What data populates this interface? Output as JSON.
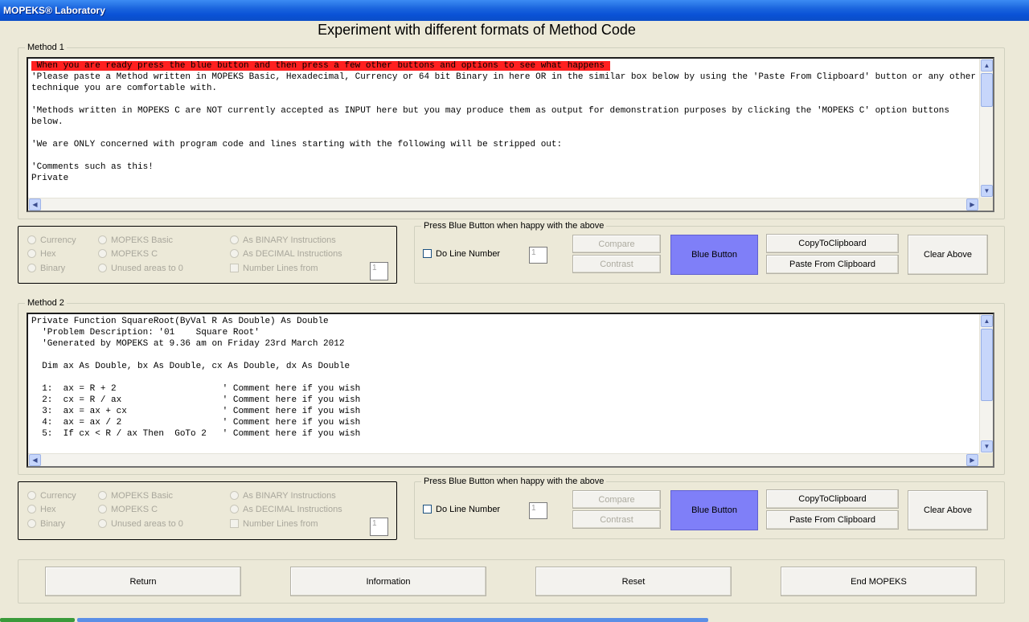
{
  "window": {
    "title": "MOPEKS® Laboratory"
  },
  "page_title": "Experiment with different formats of Method Code",
  "method1": {
    "legend": "Method 1",
    "highlight": " When you are ready press the blue button and then press a few other buttons and options to see what happens ",
    "text": "'Please paste a Method written in MOPEKS Basic, Hexadecimal, Currency or 64 bit Binary in here OR in the similar box below by using the 'Paste From Clipboard' button or any other technique you are comfortable with.\n\n'Methods written in MOPEKS C are NOT currently accepted as INPUT here but you may produce them as output for demonstration purposes by clicking the 'MOPEKS C' option buttons below.\n\n'We are ONLY concerned with program code and lines starting with the following will be stripped out:\n\n'Comments such as this!\nPrivate"
  },
  "method2": {
    "legend": "Method 2",
    "text": "Private Function SquareRoot(ByVal R As Double) As Double\n  'Problem Description: '01    Square Root'\n  'Generated by MOPEKS at 9.36 am on Friday 23rd March 2012\n\n  Dim ax As Double, bx As Double, cx As Double, dx As Double\n\n  1:  ax = R + 2                    ' Comment here if you wish\n  2:  cx = R / ax                   ' Comment here if you wish\n  3:  ax = ax + cx                  ' Comment here if you wish\n  4:  ax = ax / 2                   ' Comment here if you wish\n  5:  If cx < R / ax Then  GoTo 2   ' Comment here if you wish"
  },
  "format_options": {
    "currency": "Currency",
    "hex": "Hex",
    "binary": "Binary",
    "mopeks_basic": "MOPEKS Basic",
    "mopeks_c": "MOPEKS C",
    "unused_areas": "Unused areas to 0",
    "as_binary": "As BINARY Instructions",
    "as_decimal": "As DECIMAL Instructions",
    "number_lines": "Number Lines  from",
    "number_lines_value": "1"
  },
  "actions": {
    "legend": "Press Blue Button when happy with the above",
    "do_line_number": "Do Line Number",
    "line_number_value": "1",
    "compare": "Compare",
    "contrast": "Contrast",
    "blue_button": "Blue Button",
    "copy_to_clipboard": "CopyToClipboard",
    "paste_from_clipboard": "Paste From Clipboard",
    "clear_above": "Clear Above"
  },
  "footer": {
    "return": "Return",
    "information": "Information",
    "reset": "Reset",
    "end": "End MOPEKS"
  },
  "colors": {
    "title_bar": "#0a52d6",
    "blue_button": "#7f7ff8",
    "highlight_red": "#ff2020",
    "window_bg": "#ece9d8"
  }
}
